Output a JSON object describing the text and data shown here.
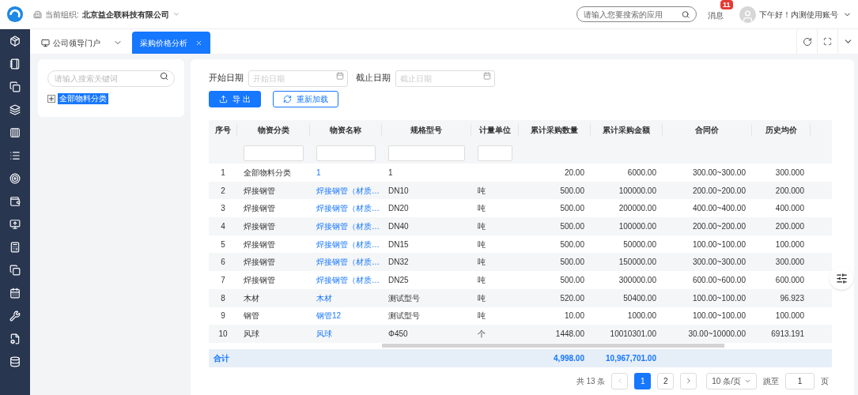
{
  "top_bar": {
    "org_label": "当前组织:",
    "org_name": "北京益企联科技有限公司",
    "search": {
      "placeholder": "请输入您要搜索的应用"
    },
    "messages": {
      "label": "消息",
      "count": "11"
    },
    "greeting": "下午好！内测使用账号"
  },
  "tabs": [
    {
      "label": "公司领导门户",
      "selected": false
    },
    {
      "label": "采购价格分析",
      "selected": true
    }
  ],
  "tree": {
    "search": {
      "placeholder": "请输入搜索关键词"
    },
    "nodes": [
      {
        "label": "全部物料分类",
        "selected": true,
        "expanded": false
      }
    ]
  },
  "filters": [
    {
      "label": "开始日期",
      "placeholder": "开始日期"
    },
    {
      "label": "截止日期",
      "placeholder": "截止日期"
    }
  ],
  "buttons": [
    {
      "label": "导 出",
      "kind": "primary"
    },
    {
      "label": "重新加载",
      "kind": "outline"
    }
  ],
  "table": {
    "columns": [
      {
        "label": "序号",
        "filterable": false
      },
      {
        "label": "物资分类",
        "filterable": true
      },
      {
        "label": "物资名称",
        "filterable": true
      },
      {
        "label": "规格型号",
        "filterable": true
      },
      {
        "label": "计量单位",
        "filterable": true
      },
      {
        "label": "累计采购数量",
        "filterable": false
      },
      {
        "label": "累计采购金额",
        "filterable": false
      },
      {
        "label": "合同价",
        "filterable": false
      },
      {
        "label": "历史均价",
        "filterable": false
      }
    ],
    "rows": [
      [
        "1",
        "全部物料分类",
        "1",
        "1",
        "",
        "20.00",
        "6000.00",
        "300.00~300.00",
        "300.000"
      ],
      [
        "2",
        "焊接钢管",
        "焊接钢管（材质…",
        "DN10",
        "吨",
        "500.00",
        "100000.00",
        "200.00~200.00",
        "200.000"
      ],
      [
        "3",
        "焊接钢管",
        "焊接钢管（材质…",
        "DN20",
        "吨",
        "500.00",
        "200000.00",
        "400.00~400.00",
        "400.000"
      ],
      [
        "4",
        "焊接钢管",
        "焊接钢管（材质…",
        "DN40",
        "吨",
        "500.00",
        "100000.00",
        "200.00~200.00",
        "200.000"
      ],
      [
        "5",
        "焊接钢管",
        "焊接钢管（材质…",
        "DN15",
        "吨",
        "500.00",
        "50000.00",
        "100.00~100.00",
        "100.000"
      ],
      [
        "6",
        "焊接钢管",
        "焊接钢管（材质…",
        "DN32",
        "吨",
        "500.00",
        "150000.00",
        "300.00~300.00",
        "300.000"
      ],
      [
        "7",
        "焊接钢管",
        "焊接钢管（材质…",
        "DN25",
        "吨",
        "500.00",
        "300000.00",
        "600.00~600.00",
        "600.000"
      ],
      [
        "8",
        "木材",
        "木材",
        "测试型号",
        "吨",
        "520.00",
        "50400.00",
        "100.00~100.00",
        "96.923"
      ],
      [
        "9",
        "钢管",
        "钢管12",
        "测试型号",
        "吨",
        "10.00",
        "1000.00",
        "100.00~100.00",
        "100.000"
      ],
      [
        "10",
        "风球",
        "风球",
        "Φ450",
        "个",
        "1448.00",
        "10010301.00",
        "30.00~10000.00",
        "6913.191"
      ]
    ],
    "totals": {
      "label": "合计",
      "quantity": "4,998.00",
      "amount": "10,967,701.00"
    }
  },
  "pagination": {
    "total": "共 13 条",
    "prev_disabled": true,
    "pages": [
      {
        "label": "1",
        "selected": true
      },
      {
        "label": "2",
        "selected": false
      }
    ],
    "page_size": "10 条/页",
    "jump_label": "跳至",
    "jump_value": "1",
    "page_suffix": "页"
  }
}
